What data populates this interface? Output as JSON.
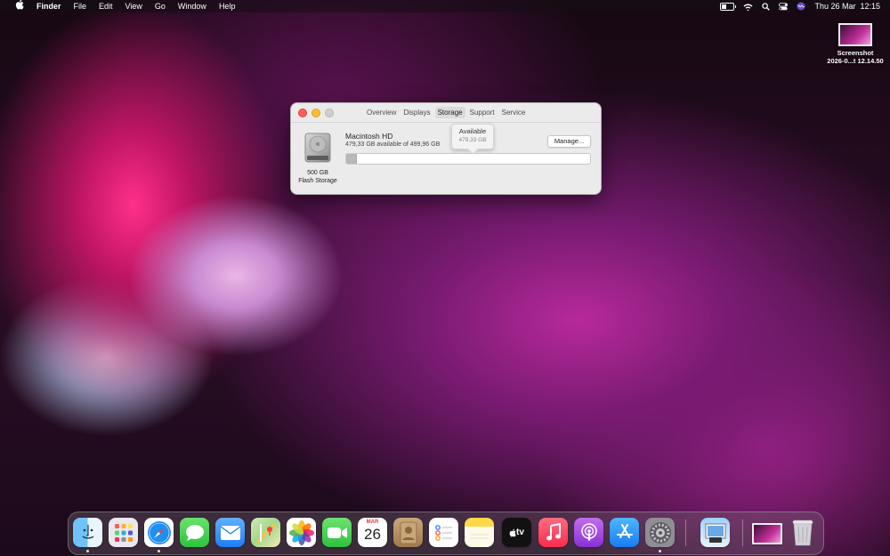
{
  "menubar": {
    "app_name": "Finder",
    "menus": [
      "File",
      "Edit",
      "View",
      "Go",
      "Window",
      "Help"
    ],
    "datetime": "Thu 26 Mar  12:15",
    "battery_level": 0.4,
    "status_icons": [
      "battery-icon",
      "wifi-icon",
      "search-icon",
      "control-center-icon",
      "siri-icon"
    ]
  },
  "desktop": {
    "file_label_line1": "Screenshot",
    "file_label_line2": "2026-0...t 12.14.50"
  },
  "about_window": {
    "tabs": [
      "Overview",
      "Displays",
      "Storage",
      "Support",
      "Service"
    ],
    "active_tab": "Storage",
    "volume_name": "Macintosh HD",
    "volume_available": "479,33 GB available of 499,96 GB",
    "capacity": "500 GB",
    "storage_type": "Flash Storage",
    "manage_label": "Manage...",
    "used_fraction": 0.041,
    "tooltip_title": "Available",
    "tooltip_value": "479,33 GB"
  },
  "dock": {
    "calendar_month": "MAR",
    "calendar_day": "26",
    "tv_label": "tv",
    "apps": [
      "Finder",
      "Launchpad",
      "Safari",
      "Messages",
      "Mail",
      "Maps",
      "Photos",
      "FaceTime",
      "Calendar",
      "Contacts",
      "Reminders",
      "Notes",
      "TV",
      "Music",
      "Podcasts",
      "App Store",
      "System Preferences",
      "Preview",
      "Screenshot",
      "Trash"
    ]
  }
}
